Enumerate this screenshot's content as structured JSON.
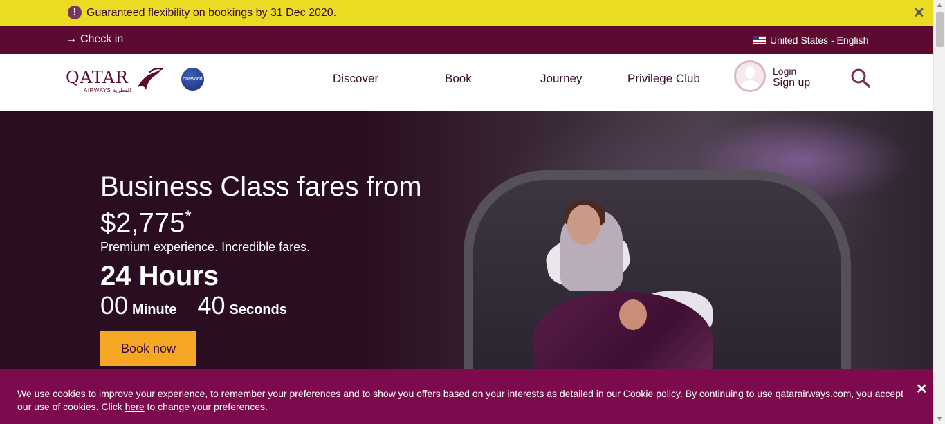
{
  "notice": {
    "message": "Guaranteed flexibility on bookings by 31 Dec 2020.",
    "alert_icon": "exclamation-icon",
    "close_label": "✕"
  },
  "topbar": {
    "checkin_label": "Check in",
    "checkin_arrow": "→",
    "locale_label": "United States - English"
  },
  "header": {
    "logo_word": "QATAR",
    "logo_sub": "AIRWAYS القطرية",
    "alliance_label": "oneworld",
    "nav": [
      "Discover",
      "Book",
      "Journey",
      "Privilege Club"
    ],
    "login_label": "Login",
    "signup_label": "Sign up"
  },
  "hero": {
    "headline_line1": "Business Class fares from",
    "headline_line2": "$2,775",
    "headline_mark": "*",
    "tagline": "Premium experience. Incredible fares.",
    "hours": "24 Hours",
    "minutes_value": "00",
    "minutes_unit": "Minute",
    "seconds_value": "40",
    "seconds_unit": "Seconds",
    "cta_label": "Book now"
  },
  "cookie": {
    "text_before_link": "We use cookies to improve your experience, to remember your preferences and to show you offers based on your interests as detailed in our ",
    "policy_link": "Cookie policy",
    "text_middle": ". By continuing to use qatarairways.com, you accept our use of cookies. Click ",
    "here_link": "here",
    "text_after": " to change your preferences.",
    "close_label": "✕"
  },
  "colors": {
    "notice_bg": "#ebdb22",
    "brand_maroon": "#5c0a32",
    "cookie_bg": "#7d0a4c",
    "cta": "#f5a623"
  }
}
